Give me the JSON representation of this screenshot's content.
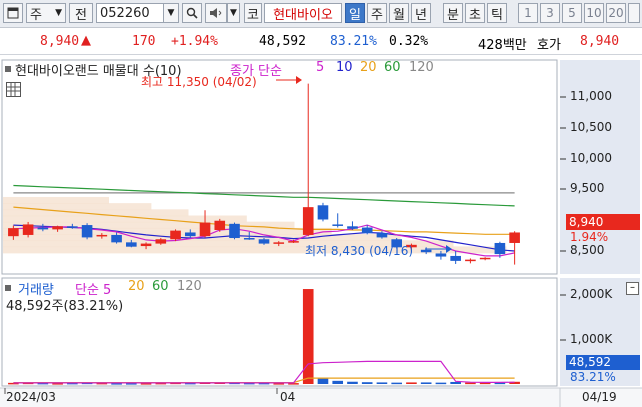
{
  "toolbar": {
    "market": "주",
    "mode": "전",
    "code": "052260",
    "company_tag": "코",
    "company_name": "현대바이오",
    "periods": [
      "일",
      "주",
      "월",
      "년",
      "분",
      "초",
      "틱"
    ],
    "selected_period": "일",
    "numbers": [
      "1",
      "3",
      "5",
      "10",
      "20"
    ]
  },
  "quote": {
    "price": "8,940",
    "arrow": "▲",
    "change": "170",
    "change_pct": "+1.94%",
    "volume": "48,592",
    "volume_ratio": "83.21%",
    "turnover": "0.32%",
    "amount": "428백만",
    "bid_label": "호가",
    "bid_price": "8,940"
  },
  "chart": {
    "legend_title": "현대바이오랜드 매물대 수(10)",
    "ma_legend": [
      "종가 단순",
      "5",
      "10",
      "20",
      "60",
      "120"
    ],
    "high_label": "최고 11,350 (04/02)",
    "low_label": "최저 8,430 (04/16)",
    "price_axis": [
      "11,000",
      "10,500",
      "10,000",
      "9,500",
      "8,500"
    ],
    "current_price_tag": "8,940",
    "current_pct_tag": "1.94%",
    "volume_legend_title": "거래량",
    "volume_ma_legend": [
      "단순 5",
      "20",
      "60",
      "120"
    ],
    "volume_info": "48,592주(83.21%)",
    "volume_axis": [
      "2,000K",
      "1,000K"
    ],
    "volume_tag": "48,592",
    "volume_pct_tag": "83.21%",
    "date_labels": [
      "2024/03",
      "04",
      "04/19"
    ],
    "colors": {
      "up": "#e8281e",
      "down": "#1e5fd0",
      "ma5": "#cc22cc",
      "ma10": "#2222cc",
      "ma20": "#e8a11a",
      "ma60": "#2a9a3a",
      "ma120": "#888888"
    }
  },
  "chart_data": {
    "type": "candlestick",
    "y_range": [
      8300,
      11700
    ],
    "candles": [
      {
        "o": 8880,
        "h": 9050,
        "l": 8820,
        "c": 9010
      },
      {
        "o": 8900,
        "h": 9110,
        "l": 8860,
        "c": 9070
      },
      {
        "o": 9020,
        "h": 9080,
        "l": 8960,
        "c": 8990
      },
      {
        "o": 8990,
        "h": 9050,
        "l": 8950,
        "c": 9040
      },
      {
        "o": 9040,
        "h": 9080,
        "l": 9000,
        "c": 9020
      },
      {
        "o": 9060,
        "h": 9090,
        "l": 8830,
        "c": 8860
      },
      {
        "o": 8880,
        "h": 8930,
        "l": 8840,
        "c": 8900
      },
      {
        "o": 8900,
        "h": 8940,
        "l": 8760,
        "c": 8780
      },
      {
        "o": 8780,
        "h": 8820,
        "l": 8700,
        "c": 8710
      },
      {
        "o": 8720,
        "h": 8780,
        "l": 8670,
        "c": 8760
      },
      {
        "o": 8760,
        "h": 8850,
        "l": 8740,
        "c": 8830
      },
      {
        "o": 8830,
        "h": 8990,
        "l": 8800,
        "c": 8970
      },
      {
        "o": 8940,
        "h": 8990,
        "l": 8850,
        "c": 8880
      },
      {
        "o": 8880,
        "h": 9300,
        "l": 8860,
        "c": 9100
      },
      {
        "o": 8980,
        "h": 9160,
        "l": 8950,
        "c": 9130
      },
      {
        "o": 9080,
        "h": 9100,
        "l": 8830,
        "c": 8850
      },
      {
        "o": 8850,
        "h": 8950,
        "l": 8820,
        "c": 8830
      },
      {
        "o": 8830,
        "h": 8850,
        "l": 8740,
        "c": 8760
      },
      {
        "o": 8760,
        "h": 8800,
        "l": 8720,
        "c": 8780
      },
      {
        "o": 8780,
        "h": 8820,
        "l": 8770,
        "c": 8800
      },
      {
        "o": 8900,
        "h": 11350,
        "l": 8880,
        "c": 9350
      },
      {
        "o": 9380,
        "h": 9420,
        "l": 9120,
        "c": 9150
      },
      {
        "o": 9070,
        "h": 9250,
        "l": 9020,
        "c": 9060
      },
      {
        "o": 9040,
        "h": 9120,
        "l": 8980,
        "c": 9000
      },
      {
        "o": 9020,
        "h": 9060,
        "l": 8910,
        "c": 8930
      },
      {
        "o": 8930,
        "h": 8960,
        "l": 8840,
        "c": 8860
      },
      {
        "o": 8830,
        "h": 8850,
        "l": 8680,
        "c": 8700
      },
      {
        "o": 8700,
        "h": 8760,
        "l": 8620,
        "c": 8740
      },
      {
        "o": 8660,
        "h": 8700,
        "l": 8590,
        "c": 8620
      },
      {
        "o": 8600,
        "h": 8640,
        "l": 8500,
        "c": 8550
      },
      {
        "o": 8560,
        "h": 8640,
        "l": 8430,
        "c": 8480
      },
      {
        "o": 8500,
        "h": 8520,
        "l": 8440,
        "c": 8500
      },
      {
        "o": 8510,
        "h": 8540,
        "l": 8490,
        "c": 8530
      },
      {
        "o": 8770,
        "h": 8790,
        "l": 8530,
        "c": 8590
      },
      {
        "o": 8770,
        "h": 8960,
        "l": 8420,
        "c": 8940
      }
    ],
    "ma5": [
      9000,
      9010,
      9020,
      9030,
      9030,
      9000,
      8980,
      8950,
      8880,
      8820,
      8800,
      8810,
      8840,
      8880,
      8980,
      9000,
      8960,
      8900,
      8860,
      8800,
      8900,
      8950,
      8960,
      9000,
      9060,
      8980,
      8900,
      8860,
      8800,
      8720,
      8640,
      8600,
      8560,
      8560,
      8610
    ],
    "ma10": [
      9060,
      9050,
      9040,
      9030,
      9020,
      9010,
      8990,
      8960,
      8930,
      8900,
      8880,
      8860,
      8850,
      8850,
      8870,
      8890,
      8880,
      8870,
      8860,
      8840,
      8850,
      8880,
      8900,
      8920,
      8940,
      8930,
      8900,
      8880,
      8860,
      8820,
      8780,
      8740,
      8700,
      8660,
      8640
    ],
    "ma20": [
      9350,
      9330,
      9310,
      9290,
      9270,
      9250,
      9230,
      9210,
      9190,
      9170,
      9150,
      9130,
      9110,
      9090,
      9070,
      9050,
      9040,
      9030,
      9010,
      9000,
      8990,
      8990,
      8990,
      8980,
      8980,
      8970,
      8960,
      8950,
      8950,
      8940,
      8930,
      8920,
      8910,
      8910,
      8910
    ],
    "ma60": [
      9700,
      9690,
      9680,
      9670,
      9660,
      9650,
      9640,
      9630,
      9620,
      9610,
      9600,
      9590,
      9580,
      9570,
      9560,
      9550,
      9540,
      9530,
      9520,
      9510,
      9510,
      9500,
      9490,
      9480,
      9470,
      9460,
      9450,
      9440,
      9430,
      9420,
      9410,
      9400,
      9390,
      9380,
      9370
    ],
    "ma120": [
      9580,
      9580,
      9580,
      9580,
      9580,
      9580,
      9580,
      9580,
      9580,
      9580,
      9580,
      9580,
      9580,
      9580,
      9580,
      9580,
      9580,
      9580,
      9580,
      9580,
      9580,
      9580,
      9580,
      9580,
      9580,
      9580,
      9580,
      9580,
      9580,
      9580,
      9580,
      9580,
      9580,
      9580,
      9580
    ],
    "volume_range": [
      0,
      2300
    ],
    "volume": [
      25,
      30,
      25,
      20,
      25,
      30,
      25,
      20,
      20,
      20,
      25,
      30,
      25,
      35,
      35,
      30,
      25,
      25,
      20,
      20,
      2100,
      120,
      70,
      50,
      40,
      35,
      30,
      35,
      35,
      30,
      45,
      30,
      30,
      30,
      49
    ],
    "volume_ma5": [
      25,
      25,
      25,
      25,
      25,
      25,
      25,
      25,
      25,
      25,
      25,
      25,
      25,
      25,
      25,
      25,
      25,
      25,
      25,
      25,
      445,
      470,
      480,
      490,
      500,
      500,
      500,
      500,
      500,
      500,
      60,
      40,
      35,
      35,
      40
    ],
    "volume_ma20": [
      30,
      30,
      30,
      30,
      30,
      30,
      30,
      30,
      30,
      30,
      30,
      30,
      30,
      30,
      30,
      30,
      30,
      30,
      30,
      30,
      130,
      130,
      130,
      130,
      130,
      130,
      130,
      130,
      130,
      130,
      130,
      130,
      130,
      130,
      130
    ],
    "volume_profile": [
      {
        "p": 8650,
        "w": 0.95
      },
      {
        "p": 8750,
        "w": 0.85
      },
      {
        "p": 8850,
        "w": 0.75
      },
      {
        "p": 8950,
        "w": 0.62
      },
      {
        "p": 9050,
        "w": 0.55
      },
      {
        "p": 9150,
        "w": 0.46
      },
      {
        "p": 9250,
        "w": 0.35
      },
      {
        "p": 9350,
        "w": 0.28
      },
      {
        "p": 9450,
        "w": 0.2
      }
    ]
  }
}
